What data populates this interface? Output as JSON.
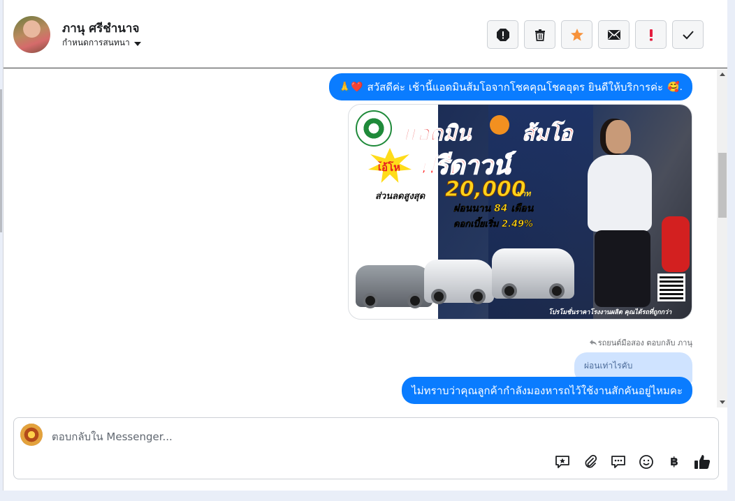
{
  "header": {
    "contact_name": "ภานุ ศรีชำนาจ",
    "assign_label": "กำหนดการสนทนา",
    "actions": [
      {
        "icon": "alert-circle-icon",
        "name": "mark-spam-button"
      },
      {
        "icon": "trash-icon",
        "name": "delete-button"
      },
      {
        "icon": "star-icon",
        "name": "star-button"
      },
      {
        "icon": "envelope-icon",
        "name": "mark-unread-button"
      },
      {
        "icon": "exclamation-icon",
        "name": "follow-up-button"
      },
      {
        "icon": "check-icon",
        "name": "mark-done-button"
      }
    ],
    "star_color": "#f7923b",
    "follow_up_color": "#e41e3f"
  },
  "messages": {
    "greeting_emoji": "🙏❤️",
    "greeting_text": "สวัสดีค่ะ เช้านี้แอดมินส้มโอจากโชคคุณโชคอุดร ยินดีให้บริการค่ะ",
    "greeting_end_emoji": "🥰.",
    "promo": {
      "title_left": "แอดมิน",
      "title_right": "ส้มโอ",
      "burst": "โอ้โห",
      "headline": "ฟรีดาวน์",
      "discount_label": "ส่วนลดสูงสุด",
      "discount_amount": "20,000",
      "discount_unit": "บาท",
      "installment": "ผ่อนนาน 84 เดือน",
      "interest": "ดอกเบี้ยเริ่ม 2.49%",
      "footer": "โปรโมชั่นราคาโรงงานผลิต คุณได้รถที่ถูกกว่า"
    },
    "reply_note": "รถยนต์มือสอง ตอบกลับ ภานุ",
    "reply_quote": "ผ่อนเท่าไรคับ",
    "last_message": "ไม่ทราบว่าคุณลูกค้ากำลังมองหารถไว้ใช้งานสักคันอยู่ไหมคะ"
  },
  "composer": {
    "placeholder": "ตอบกลับใน Messenger...",
    "tools": [
      "saved-reply-icon",
      "attachment-icon",
      "chat-bubbles-icon",
      "emoji-icon",
      "baht-icon",
      "like-icon"
    ],
    "baht_symbol": "฿",
    "accent": "#0a7cff"
  }
}
